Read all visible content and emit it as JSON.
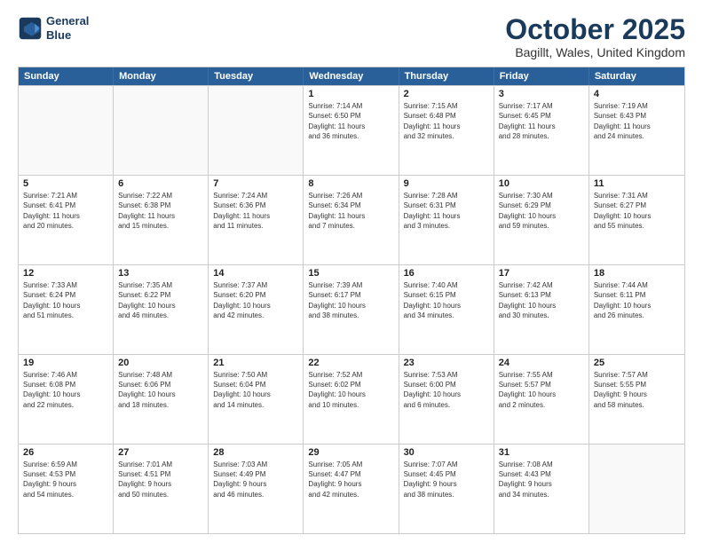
{
  "header": {
    "logo_line1": "General",
    "logo_line2": "Blue",
    "month_title": "October 2025",
    "location": "Bagillt, Wales, United Kingdom"
  },
  "day_headers": [
    "Sunday",
    "Monday",
    "Tuesday",
    "Wednesday",
    "Thursday",
    "Friday",
    "Saturday"
  ],
  "weeks": [
    [
      {
        "num": "",
        "info": ""
      },
      {
        "num": "",
        "info": ""
      },
      {
        "num": "",
        "info": ""
      },
      {
        "num": "1",
        "info": "Sunrise: 7:14 AM\nSunset: 6:50 PM\nDaylight: 11 hours\nand 36 minutes."
      },
      {
        "num": "2",
        "info": "Sunrise: 7:15 AM\nSunset: 6:48 PM\nDaylight: 11 hours\nand 32 minutes."
      },
      {
        "num": "3",
        "info": "Sunrise: 7:17 AM\nSunset: 6:45 PM\nDaylight: 11 hours\nand 28 minutes."
      },
      {
        "num": "4",
        "info": "Sunrise: 7:19 AM\nSunset: 6:43 PM\nDaylight: 11 hours\nand 24 minutes."
      }
    ],
    [
      {
        "num": "5",
        "info": "Sunrise: 7:21 AM\nSunset: 6:41 PM\nDaylight: 11 hours\nand 20 minutes."
      },
      {
        "num": "6",
        "info": "Sunrise: 7:22 AM\nSunset: 6:38 PM\nDaylight: 11 hours\nand 15 minutes."
      },
      {
        "num": "7",
        "info": "Sunrise: 7:24 AM\nSunset: 6:36 PM\nDaylight: 11 hours\nand 11 minutes."
      },
      {
        "num": "8",
        "info": "Sunrise: 7:26 AM\nSunset: 6:34 PM\nDaylight: 11 hours\nand 7 minutes."
      },
      {
        "num": "9",
        "info": "Sunrise: 7:28 AM\nSunset: 6:31 PM\nDaylight: 11 hours\nand 3 minutes."
      },
      {
        "num": "10",
        "info": "Sunrise: 7:30 AM\nSunset: 6:29 PM\nDaylight: 10 hours\nand 59 minutes."
      },
      {
        "num": "11",
        "info": "Sunrise: 7:31 AM\nSunset: 6:27 PM\nDaylight: 10 hours\nand 55 minutes."
      }
    ],
    [
      {
        "num": "12",
        "info": "Sunrise: 7:33 AM\nSunset: 6:24 PM\nDaylight: 10 hours\nand 51 minutes."
      },
      {
        "num": "13",
        "info": "Sunrise: 7:35 AM\nSunset: 6:22 PM\nDaylight: 10 hours\nand 46 minutes."
      },
      {
        "num": "14",
        "info": "Sunrise: 7:37 AM\nSunset: 6:20 PM\nDaylight: 10 hours\nand 42 minutes."
      },
      {
        "num": "15",
        "info": "Sunrise: 7:39 AM\nSunset: 6:17 PM\nDaylight: 10 hours\nand 38 minutes."
      },
      {
        "num": "16",
        "info": "Sunrise: 7:40 AM\nSunset: 6:15 PM\nDaylight: 10 hours\nand 34 minutes."
      },
      {
        "num": "17",
        "info": "Sunrise: 7:42 AM\nSunset: 6:13 PM\nDaylight: 10 hours\nand 30 minutes."
      },
      {
        "num": "18",
        "info": "Sunrise: 7:44 AM\nSunset: 6:11 PM\nDaylight: 10 hours\nand 26 minutes."
      }
    ],
    [
      {
        "num": "19",
        "info": "Sunrise: 7:46 AM\nSunset: 6:08 PM\nDaylight: 10 hours\nand 22 minutes."
      },
      {
        "num": "20",
        "info": "Sunrise: 7:48 AM\nSunset: 6:06 PM\nDaylight: 10 hours\nand 18 minutes."
      },
      {
        "num": "21",
        "info": "Sunrise: 7:50 AM\nSunset: 6:04 PM\nDaylight: 10 hours\nand 14 minutes."
      },
      {
        "num": "22",
        "info": "Sunrise: 7:52 AM\nSunset: 6:02 PM\nDaylight: 10 hours\nand 10 minutes."
      },
      {
        "num": "23",
        "info": "Sunrise: 7:53 AM\nSunset: 6:00 PM\nDaylight: 10 hours\nand 6 minutes."
      },
      {
        "num": "24",
        "info": "Sunrise: 7:55 AM\nSunset: 5:57 PM\nDaylight: 10 hours\nand 2 minutes."
      },
      {
        "num": "25",
        "info": "Sunrise: 7:57 AM\nSunset: 5:55 PM\nDaylight: 9 hours\nand 58 minutes."
      }
    ],
    [
      {
        "num": "26",
        "info": "Sunrise: 6:59 AM\nSunset: 4:53 PM\nDaylight: 9 hours\nand 54 minutes."
      },
      {
        "num": "27",
        "info": "Sunrise: 7:01 AM\nSunset: 4:51 PM\nDaylight: 9 hours\nand 50 minutes."
      },
      {
        "num": "28",
        "info": "Sunrise: 7:03 AM\nSunset: 4:49 PM\nDaylight: 9 hours\nand 46 minutes."
      },
      {
        "num": "29",
        "info": "Sunrise: 7:05 AM\nSunset: 4:47 PM\nDaylight: 9 hours\nand 42 minutes."
      },
      {
        "num": "30",
        "info": "Sunrise: 7:07 AM\nSunset: 4:45 PM\nDaylight: 9 hours\nand 38 minutes."
      },
      {
        "num": "31",
        "info": "Sunrise: 7:08 AM\nSunset: 4:43 PM\nDaylight: 9 hours\nand 34 minutes."
      },
      {
        "num": "",
        "info": ""
      }
    ]
  ]
}
